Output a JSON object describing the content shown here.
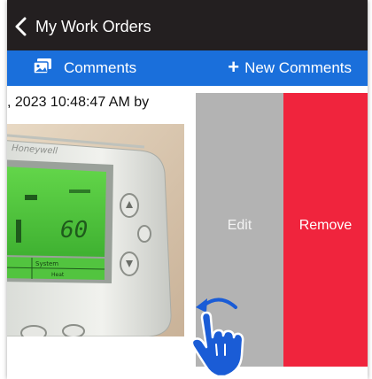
{
  "nav": {
    "back_icon": "chevron-left-icon",
    "title": "My Work Orders"
  },
  "toolbar": {
    "comments_icon": "photo-gallery-icon",
    "comments_label": "Comments",
    "new_icon": "plus-icon",
    "new_label": "New Comments"
  },
  "comment": {
    "meta": ", 2023 10:48:47 AM by"
  },
  "photo": {
    "brand": "Honeywell",
    "display_value": "60",
    "row_label_1": "System",
    "row_label_2": "Heat"
  },
  "swipe_actions": [
    {
      "label": "Edit",
      "color": "#b3b3b3"
    },
    {
      "label": "Remove",
      "color": "#f0243d"
    }
  ],
  "gesture": {
    "icon": "swipe-left-hand-icon",
    "color": "#1a5cd6"
  },
  "colors": {
    "nav_bg": "#231f20",
    "toolbar_bg": "#1a6fdb"
  }
}
